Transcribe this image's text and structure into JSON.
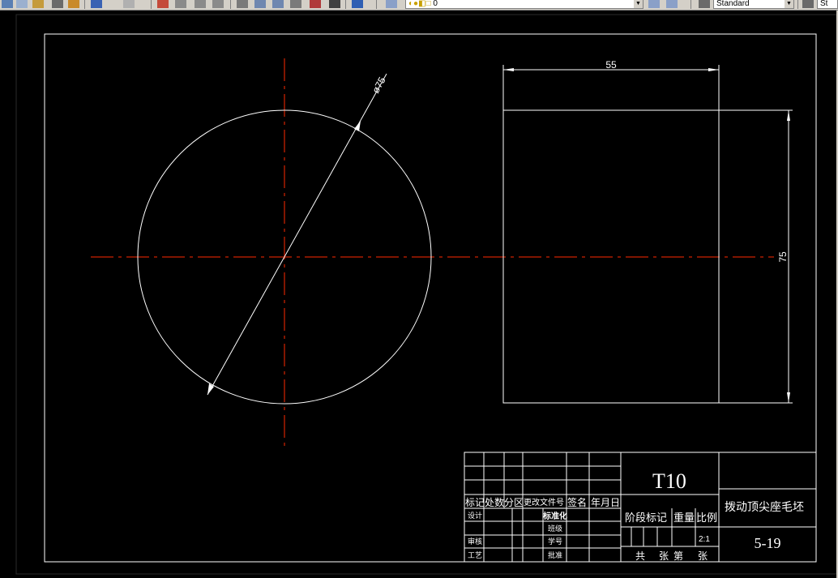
{
  "toolbar": {
    "layer_value": "0",
    "textstyle_value": "Standard",
    "dimstyle_value": "St"
  },
  "drawing": {
    "circle_dim": "ø75",
    "width_dim": "55",
    "height_dim": "75"
  },
  "title_block": {
    "part_name": "T10",
    "drawing_title": "拨动顶尖座毛坯",
    "drawing_number": "5-19",
    "scale": "2:1",
    "headers": {
      "mark": "标记",
      "count": "处数",
      "zone": "分区",
      "change_doc": "更改文件号",
      "signature": "签名",
      "date": "年月日"
    },
    "rows": {
      "design": "设计",
      "standardize": "标准化",
      "class": "班级",
      "review": "审核",
      "student_no": "学号",
      "process": "工艺",
      "approve": "批准"
    },
    "stage_mark": "阶段标记",
    "weight": "重量",
    "ratio": "比例",
    "sheet_total": "共",
    "sheet_unit": "张",
    "sheet_no": "第",
    "sheet_unit2": "张"
  },
  "colors": {
    "background": "#000000",
    "lines": "#ffffff",
    "centerline": "#ff2a00"
  }
}
